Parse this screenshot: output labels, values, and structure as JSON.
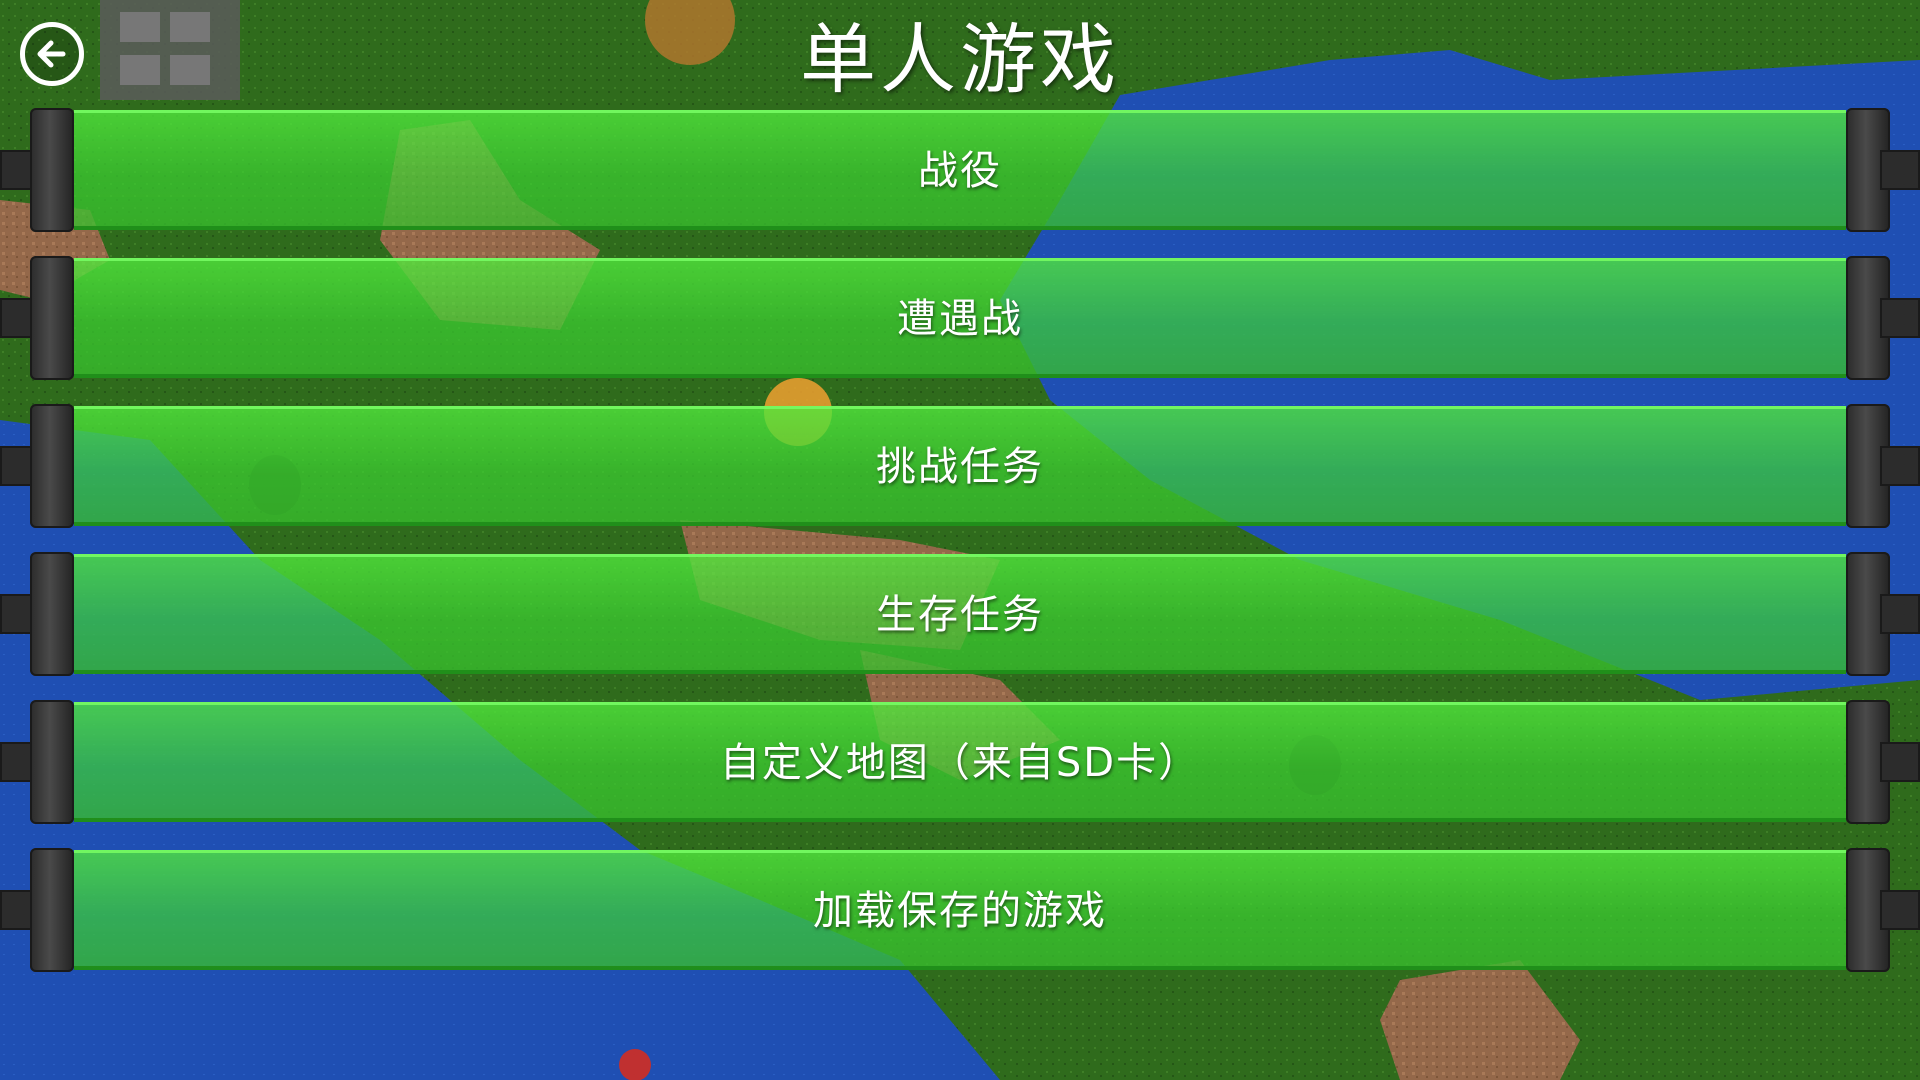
{
  "header": {
    "title": "单人游戏",
    "back_icon": "back-arrow-icon"
  },
  "menu": {
    "items": [
      {
        "label": "战役"
      },
      {
        "label": "遭遇战"
      },
      {
        "label": "挑战任务"
      },
      {
        "label": "生存任务"
      },
      {
        "label": "自定义地图（来自SD卡）"
      },
      {
        "label": "加载保存的游戏"
      }
    ]
  },
  "colors": {
    "panel_green": "#3cd232",
    "water_blue": "#1e50b4",
    "grass_green": "#2f6b1c",
    "dirt_brown": "#9a6a4a",
    "text": "#ffffff"
  }
}
